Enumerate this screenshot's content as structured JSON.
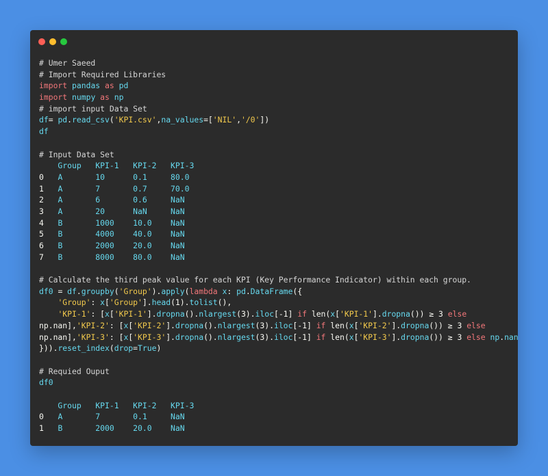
{
  "window": {
    "controls": [
      {
        "name": "close",
        "color": "#ff5f56"
      },
      {
        "name": "minimize",
        "color": "#ffbd2e"
      },
      {
        "name": "maximize",
        "color": "#27c93f"
      }
    ]
  },
  "code_lines": [
    [
      [
        "c",
        "# Umer Saeed"
      ]
    ],
    [
      [
        "c",
        "# Import Required Libraries"
      ]
    ],
    [
      [
        "k",
        "import "
      ],
      [
        "m",
        "pandas "
      ],
      [
        "k",
        "as "
      ],
      [
        "m",
        "pd"
      ]
    ],
    [
      [
        "k",
        "import "
      ],
      [
        "m",
        "numpy "
      ],
      [
        "k",
        "as "
      ],
      [
        "m",
        "np"
      ]
    ],
    [
      [
        "c",
        "# import input Data Set"
      ]
    ],
    [
      [
        "v",
        "df"
      ],
      [
        "p",
        "= "
      ],
      [
        "m",
        "pd"
      ],
      [
        "p",
        "."
      ],
      [
        "m",
        "read_csv"
      ],
      [
        "p",
        "("
      ],
      [
        "s",
        "'KPI.csv'"
      ],
      [
        "p",
        ","
      ],
      [
        "m",
        "na_values"
      ],
      [
        "p",
        "=["
      ],
      [
        "s",
        "'NIL'"
      ],
      [
        "p",
        ","
      ],
      [
        "s",
        "'/0'"
      ],
      [
        "p",
        "])"
      ]
    ],
    [
      [
        "v",
        "df"
      ]
    ],
    [],
    [
      [
        "c",
        "# Input Data Set"
      ]
    ],
    [
      [
        "m",
        "    Group   KPI-1   KPI-2   KPI-3"
      ]
    ],
    [
      [
        "p",
        "0   "
      ],
      [
        "m",
        "A       10      0.1     80.0"
      ]
    ],
    [
      [
        "p",
        "1   "
      ],
      [
        "m",
        "A       7       0.7     70.0"
      ]
    ],
    [
      [
        "p",
        "2   "
      ],
      [
        "m",
        "A       6       0.6     NaN"
      ]
    ],
    [
      [
        "p",
        "3   "
      ],
      [
        "m",
        "A       20      NaN     NaN"
      ]
    ],
    [
      [
        "p",
        "4   "
      ],
      [
        "m",
        "B       1000    10.0    NaN"
      ]
    ],
    [
      [
        "p",
        "5   "
      ],
      [
        "m",
        "B       4000    40.0    NaN"
      ]
    ],
    [
      [
        "p",
        "6   "
      ],
      [
        "m",
        "B       2000    20.0    NaN"
      ]
    ],
    [
      [
        "p",
        "7   "
      ],
      [
        "m",
        "B       8000    80.0    NaN"
      ]
    ],
    [],
    [
      [
        "c",
        "# Calculate the third peak value for each KPI (Key Performance Indicator) within each group."
      ]
    ],
    [
      [
        "v",
        "df0 "
      ],
      [
        "p",
        "= "
      ],
      [
        "v",
        "df"
      ],
      [
        "p",
        "."
      ],
      [
        "m",
        "groupby"
      ],
      [
        "p",
        "("
      ],
      [
        "s",
        "'Group'"
      ],
      [
        "p",
        ")."
      ],
      [
        "m",
        "apply"
      ],
      [
        "p",
        "("
      ],
      [
        "k",
        "lambda "
      ],
      [
        "m",
        "x"
      ],
      [
        "p",
        ": "
      ],
      [
        "m",
        "pd"
      ],
      [
        "p",
        "."
      ],
      [
        "m",
        "DataFrame"
      ],
      [
        "p",
        "({"
      ]
    ],
    [
      [
        "p",
        "    "
      ],
      [
        "s",
        "'Group'"
      ],
      [
        "p",
        ": "
      ],
      [
        "m",
        "x"
      ],
      [
        "p",
        "["
      ],
      [
        "s",
        "'Group'"
      ],
      [
        "p",
        "]."
      ],
      [
        "m",
        "head"
      ],
      [
        "p",
        "(1)."
      ],
      [
        "m",
        "tolist"
      ],
      [
        "p",
        "(),"
      ]
    ],
    [
      [
        "p",
        "    "
      ],
      [
        "s",
        "'KPI-1'"
      ],
      [
        "p",
        ": ["
      ],
      [
        "m",
        "x"
      ],
      [
        "p",
        "["
      ],
      [
        "s",
        "'KPI-1'"
      ],
      [
        "p",
        "]."
      ],
      [
        "m",
        "dropna"
      ],
      [
        "p",
        "()."
      ],
      [
        "m",
        "nlargest"
      ],
      [
        "p",
        "(3)."
      ],
      [
        "m",
        "iloc"
      ],
      [
        "p",
        "[-1] "
      ],
      [
        "k",
        "if "
      ],
      [
        "p",
        "len("
      ],
      [
        "m",
        "x"
      ],
      [
        "p",
        "["
      ],
      [
        "s",
        "'KPI-1'"
      ],
      [
        "p",
        "]."
      ],
      [
        "m",
        "dropna"
      ],
      [
        "p",
        "()) ≥ 3 "
      ],
      [
        "k",
        "else"
      ]
    ],
    [
      [
        "p",
        "np.nan"
      ],
      [
        "p",
        "],"
      ],
      [
        "s",
        "'KPI-2'"
      ],
      [
        "p",
        ": ["
      ],
      [
        "m",
        "x"
      ],
      [
        "p",
        "["
      ],
      [
        "s",
        "'KPI-2'"
      ],
      [
        "p",
        "]."
      ],
      [
        "m",
        "dropna"
      ],
      [
        "p",
        "()."
      ],
      [
        "m",
        "nlargest"
      ],
      [
        "p",
        "(3)."
      ],
      [
        "m",
        "iloc"
      ],
      [
        "p",
        "[-1] "
      ],
      [
        "k",
        "if "
      ],
      [
        "p",
        "len("
      ],
      [
        "m",
        "x"
      ],
      [
        "p",
        "["
      ],
      [
        "s",
        "'KPI-2'"
      ],
      [
        "p",
        "]."
      ],
      [
        "m",
        "dropna"
      ],
      [
        "p",
        "()) ≥ 3 "
      ],
      [
        "k",
        "else"
      ]
    ],
    [
      [
        "p",
        "np.nan"
      ],
      [
        "p",
        "],"
      ],
      [
        "s",
        "'KPI-3'"
      ],
      [
        "p",
        ": ["
      ],
      [
        "m",
        "x"
      ],
      [
        "p",
        "["
      ],
      [
        "s",
        "'KPI-3'"
      ],
      [
        "p",
        "]."
      ],
      [
        "m",
        "dropna"
      ],
      [
        "p",
        "()."
      ],
      [
        "m",
        "nlargest"
      ],
      [
        "p",
        "(3)."
      ],
      [
        "m",
        "iloc"
      ],
      [
        "p",
        "[-1] "
      ],
      [
        "k",
        "if "
      ],
      [
        "p",
        "len("
      ],
      [
        "m",
        "x"
      ],
      [
        "p",
        "["
      ],
      [
        "s",
        "'KPI-3'"
      ],
      [
        "p",
        "]."
      ],
      [
        "m",
        "dropna"
      ],
      [
        "p",
        "()) ≥ 3 "
      ],
      [
        "k",
        "else "
      ],
      [
        "m",
        "np"
      ],
      [
        "p",
        "."
      ],
      [
        "m",
        "nan"
      ],
      [
        "p",
        "]"
      ]
    ],
    [
      [
        "p",
        "}))."
      ],
      [
        "m",
        "reset_index"
      ],
      [
        "p",
        "("
      ],
      [
        "m",
        "drop"
      ],
      [
        "p",
        "="
      ],
      [
        "m",
        "True"
      ],
      [
        "p",
        ")"
      ]
    ],
    [],
    [
      [
        "c",
        "# Requied Ouput"
      ]
    ],
    [
      [
        "v",
        "df0"
      ]
    ],
    [],
    [
      [
        "m",
        "    Group   KPI-1   KPI-2   KPI-3"
      ]
    ],
    [
      [
        "p",
        "0   "
      ],
      [
        "m",
        "A       7       0.1     NaN"
      ]
    ],
    [
      [
        "p",
        "1   "
      ],
      [
        "m",
        "B       2000    20.0    NaN"
      ]
    ]
  ]
}
